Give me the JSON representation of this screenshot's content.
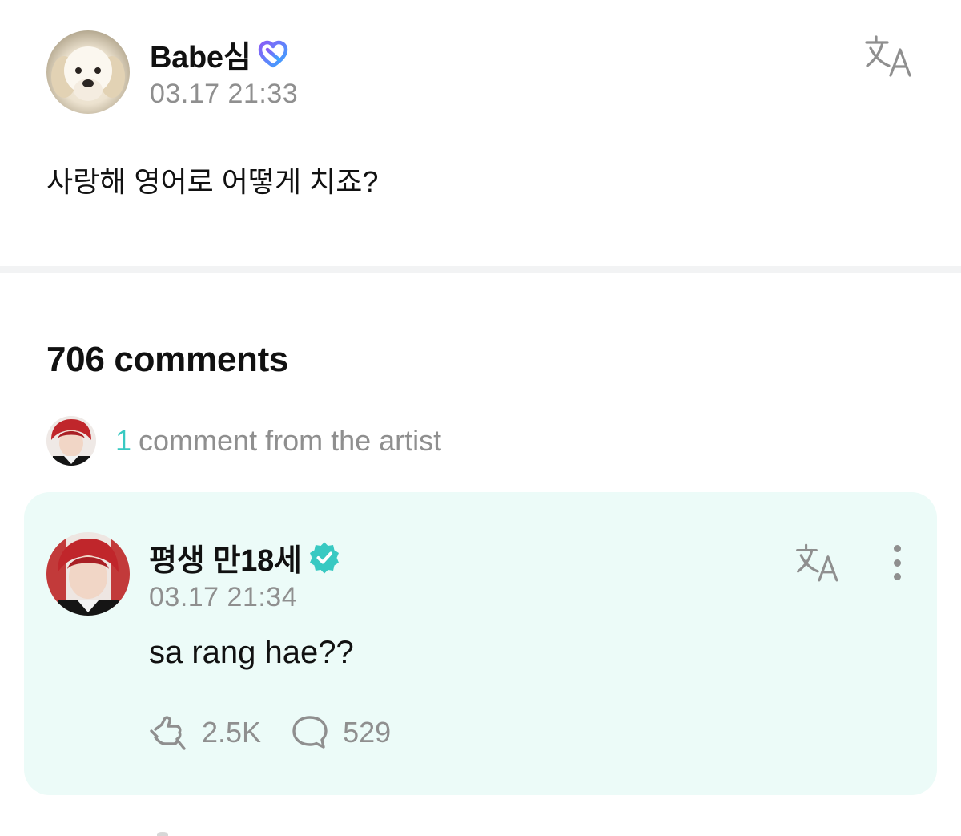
{
  "post": {
    "author": "Babe심",
    "timestamp": "03.17 21:33",
    "body": "사랑해 영어로 어떻게 치죠?",
    "author_badge_icon": "heart-membership-icon",
    "translate_icon": "translate-icon"
  },
  "comments": {
    "count_label": "706 comments",
    "artist_summary": {
      "count": "1",
      "label": "comment from the artist"
    }
  },
  "artist_comment": {
    "author": "평생 만18세",
    "timestamp": "03.17 21:34",
    "body": "sa rang hae??",
    "verified_icon": "verified-badge-icon",
    "likes": "2.5K",
    "replies": "529",
    "like_icon": "like-hand-icon",
    "reply_icon": "comment-bubble-icon"
  },
  "colors": {
    "accent": "#38c9c2",
    "card_background": "#ecfbf8",
    "muted_text": "#8f8f8f",
    "divider": "#f2f3f4",
    "heart_gradient_start": "#8a5cf6",
    "heart_gradient_end": "#3aa7ff"
  }
}
